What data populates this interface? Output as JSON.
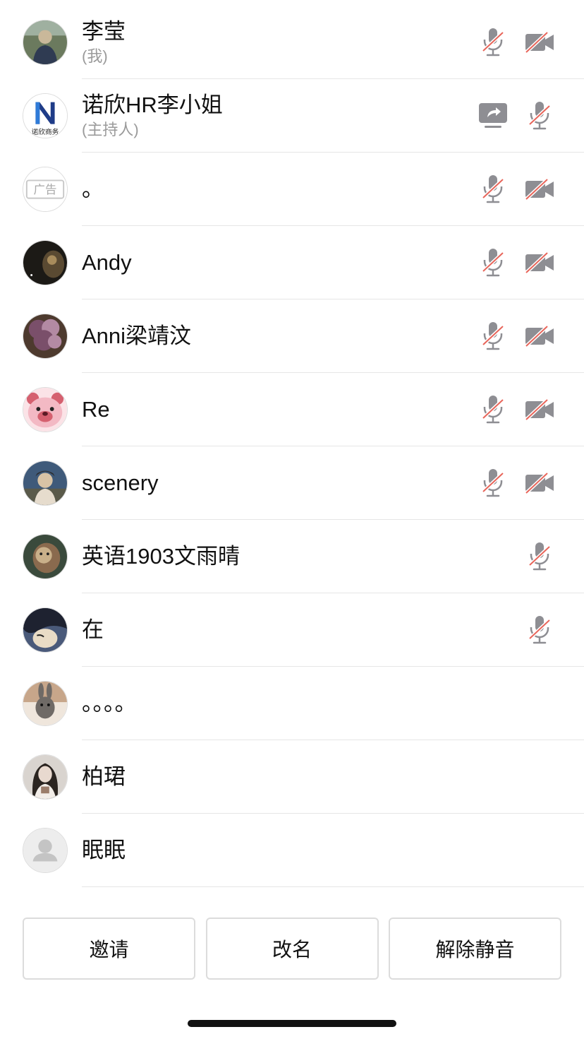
{
  "participants": [
    {
      "name": "李莹",
      "role": "(我)",
      "icons": [
        "mic-muted",
        "camera-off"
      ],
      "avatar": "photo-child",
      "avatar_colors": [
        "#6b7a5e",
        "#2f3b52",
        "#c9b89a"
      ]
    },
    {
      "name": "诺欣HR李小姐",
      "role": "(主持人)",
      "icons": [
        "screen-share",
        "mic-muted"
      ],
      "avatar": "logo",
      "avatar_logo_text": "N",
      "avatar_logo_caption": "诺欣商务"
    },
    {
      "name": "。",
      "role": "",
      "icons": [
        "mic-muted",
        "camera-off"
      ],
      "avatar": "ad-badge",
      "avatar_badge_text": "广告"
    },
    {
      "name": "Andy",
      "role": "",
      "icons": [
        "mic-muted",
        "camera-off"
      ],
      "avatar": "photo-dark",
      "avatar_colors": [
        "#1c1a16",
        "#5a4a32",
        "#a88c5c"
      ]
    },
    {
      "name": "Anni梁靖汶",
      "role": "",
      "icons": [
        "mic-muted",
        "camera-off"
      ],
      "avatar": "photo-flowers",
      "avatar_colors": [
        "#7a4f6a",
        "#b38aa3",
        "#4d3a2e"
      ]
    },
    {
      "name": "Re",
      "role": "",
      "icons": [
        "mic-muted",
        "camera-off"
      ],
      "avatar": "photo-bear",
      "avatar_colors": [
        "#f3b9c4",
        "#d5606f",
        "#fbe3e7"
      ]
    },
    {
      "name": "scenery",
      "role": "",
      "icons": [
        "mic-muted",
        "camera-off"
      ],
      "avatar": "photo-person",
      "avatar_colors": [
        "#3f5a7a",
        "#d8c3a5",
        "#2b2b2b"
      ]
    },
    {
      "name": "英语1903文雨晴",
      "role": "",
      "icons": [
        "mic-muted"
      ],
      "avatar": "photo-dog",
      "avatar_colors": [
        "#3a4a3c",
        "#8a6a4e",
        "#c9b08a"
      ]
    },
    {
      "name": "在",
      "role": "",
      "icons": [
        "mic-muted"
      ],
      "avatar": "photo-anime",
      "avatar_colors": [
        "#1e2230",
        "#e9dcc6",
        "#4a5a7a"
      ]
    },
    {
      "name": "。。。。",
      "role": "",
      "icons": [],
      "avatar": "photo-rabbit",
      "avatar_colors": [
        "#c7a68a",
        "#6f6a66",
        "#efe6dc"
      ]
    },
    {
      "name": "柏珺",
      "role": "",
      "icons": [],
      "avatar": "photo-girl",
      "avatar_colors": [
        "#2a2420",
        "#e8d9cf",
        "#9a7c6a"
      ]
    },
    {
      "name": "眠眠",
      "role": "",
      "icons": [],
      "avatar": "placeholder",
      "avatar_colors": [
        "#ededed",
        "#c4c4c4",
        "#c4c4c4"
      ]
    }
  ],
  "actions": {
    "invite": "邀请",
    "rename": "改名",
    "unmute": "解除静音"
  },
  "colors": {
    "icon_gray": "#8e8e93",
    "muted_slash": "#e8655a",
    "divider": "#e6e6e6",
    "button_border": "#dcdcdc"
  }
}
